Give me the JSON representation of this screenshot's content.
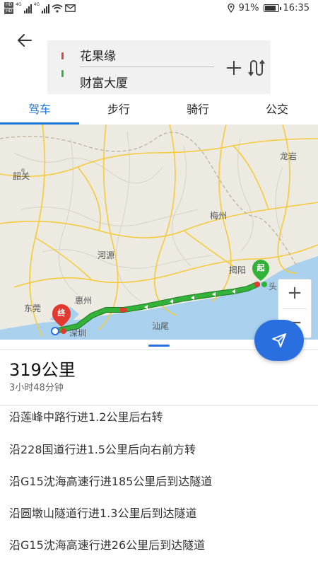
{
  "status_bar": {
    "hd_badges": [
      "HD",
      "HD"
    ],
    "network": "4G",
    "battery_percent": "91%",
    "battery_level": 0.91,
    "time": "16:35"
  },
  "header": {
    "origin": "花果缘",
    "destination": "财富大厦"
  },
  "tabs": [
    {
      "label": "驾车",
      "active": true
    },
    {
      "label": "步行",
      "active": false
    },
    {
      "label": "骑行",
      "active": false
    },
    {
      "label": "公交",
      "active": false
    }
  ],
  "map": {
    "labels": {
      "shaoguan": "韶关",
      "longyan": "龙岩",
      "meizhou": "梅州",
      "heyuan": "河源",
      "jieyang": "揭阳",
      "huizhou": "惠州",
      "dongguan": "东莞",
      "shanwei": "汕尾",
      "shenzhen": "深圳",
      "shantou": "头"
    },
    "start_marker": "起",
    "end_marker": "终",
    "zoom_in": "+",
    "zoom_out": "−",
    "colors": {
      "route_green": "#33b23a",
      "route_red": "#e23a30",
      "province_border": "#f5c936",
      "water": "#a9d1ee",
      "land": "#edeae2"
    }
  },
  "summary": {
    "distance": "319公里",
    "duration": "3小时48分钟"
  },
  "steps": [
    "沿莲峰中路行进1.2公里后右转",
    "沿228国道行进1.5公里后向右前方转",
    "沿G15沈海高速行进185公里后到达隧道",
    "沿圆墩山隧道行进1.3公里后到达隧道",
    "沿G15沈海高速行进26公里后到达隧道"
  ],
  "icons": {
    "back": "arrow-left-icon",
    "add": "plus-icon",
    "swap": "route-swap-icon",
    "navigate": "navigation-arrow-icon"
  }
}
